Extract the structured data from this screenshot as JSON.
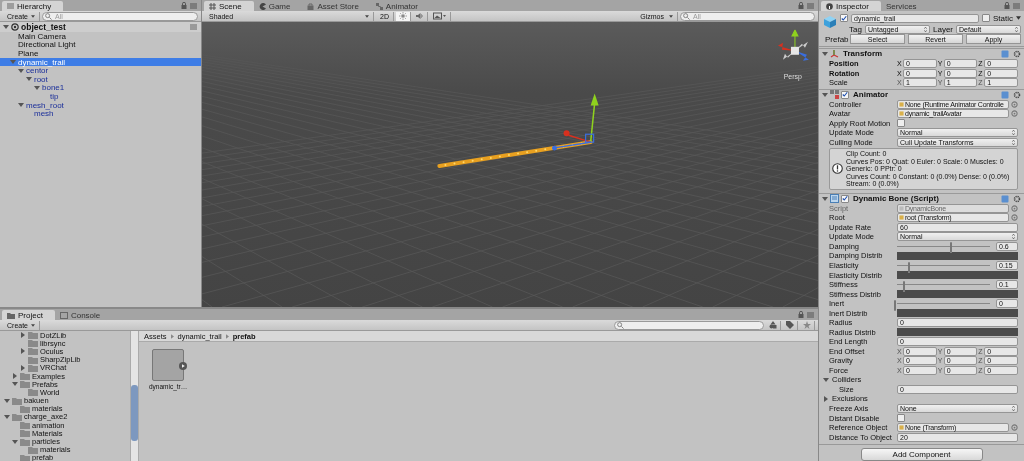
{
  "hierarchy": {
    "title": "Hierarchy",
    "create": "Create",
    "search_placeholder": "All",
    "scene": {
      "label": "object_test",
      "expanded": true,
      "children": [
        {
          "label": "Main Camera",
          "prefab": false,
          "selected": false
        },
        {
          "label": "Directional Light",
          "prefab": false,
          "selected": false
        },
        {
          "label": "Plane",
          "prefab": false,
          "selected": false
        },
        {
          "label": "dynamic_trail",
          "prefab": true,
          "selected": true,
          "expanded": true,
          "children": [
            {
              "label": "centor",
              "prefab": true,
              "selected": false,
              "expanded": true,
              "children": [
                {
                  "label": "root",
                  "prefab": true,
                  "selected": false,
                  "expanded": true,
                  "children": [
                    {
                      "label": "bone1",
                      "prefab": true,
                      "selected": false,
                      "expanded": true,
                      "children": [
                        {
                          "label": "tip",
                          "prefab": true,
                          "selected": false
                        }
                      ]
                    }
                  ]
                }
              ]
            },
            {
              "label": "mesh_root",
              "prefab": true,
              "selected": false,
              "expanded": true,
              "children": [
                {
                  "label": "mesh",
                  "prefab": true,
                  "selected": false
                }
              ]
            }
          ]
        }
      ]
    }
  },
  "scene_view": {
    "tabs": [
      {
        "label": "Scene",
        "selected": true
      },
      {
        "label": "Game",
        "selected": false
      },
      {
        "label": "Asset Store",
        "selected": false
      },
      {
        "label": "Animator",
        "selected": false
      }
    ],
    "shading": "Shaded",
    "mode_2d": "2D",
    "lighting": true,
    "audio": false,
    "gizmos": "Gizmos",
    "search_placeholder": "All",
    "projection": "Persp"
  },
  "inspector": {
    "tabs": [
      {
        "label": "Inspector",
        "selected": true
      },
      {
        "label": "Services",
        "selected": false
      }
    ],
    "object": {
      "active": true,
      "name": "dynamic_trail",
      "static": false,
      "static_label": "Static",
      "tag_label": "Tag",
      "tag": "Untagged",
      "layer_label": "Layer",
      "layer": "Default",
      "prefab_label": "Prefab",
      "prefab_buttons": [
        "Select",
        "Revert",
        "Apply"
      ]
    },
    "components": [
      {
        "kind": "transform",
        "title": "Transform",
        "rows": [
          {
            "kind": "vector",
            "label": "Position",
            "modified": true,
            "values": [
              {
                "axis": "X",
                "value": "0"
              },
              {
                "axis": "Y",
                "value": "0"
              },
              {
                "axis": "Z",
                "value": "0"
              }
            ]
          },
          {
            "kind": "vector",
            "label": "Rotation",
            "modified": true,
            "values": [
              {
                "axis": "X",
                "value": "0"
              },
              {
                "axis": "Y",
                "value": "0"
              },
              {
                "axis": "Z",
                "value": "0"
              }
            ]
          },
          {
            "kind": "vector",
            "label": "Scale",
            "modified": false,
            "values": [
              {
                "axis": "X",
                "value": "1"
              },
              {
                "axis": "Y",
                "value": "1"
              },
              {
                "axis": "Z",
                "value": "1"
              }
            ]
          }
        ]
      },
      {
        "kind": "animator",
        "title": "Animator",
        "enabled": true,
        "rows": [
          {
            "kind": "object",
            "label": "Controller",
            "value": "None (Runtime Animator Controlle",
            "disabled": false
          },
          {
            "kind": "object",
            "label": "Avatar",
            "value": "dynamic_trailAvatar",
            "disabled": false
          },
          {
            "kind": "checkbox",
            "label": "Apply Root Motion",
            "checked": false
          },
          {
            "kind": "dropdown",
            "label": "Update Mode",
            "value": "Normal"
          },
          {
            "kind": "dropdown",
            "label": "Culling Mode",
            "value": "Cull Update Transforms"
          }
        ],
        "info": [
          "Clip Count: 0",
          "Curves Pos: 0 Quat: 0 Euler: 0 Scale: 0 Muscles: 0 Generic: 0 PPtr: 0",
          "Curves Count: 0 Constant: 0 (0.0%) Dense: 0 (0.0%) Stream: 0 (0.0%)"
        ]
      },
      {
        "kind": "script",
        "title": "Dynamic Bone (Script)",
        "enabled": true,
        "rows": [
          {
            "kind": "object",
            "label": "Script",
            "value": "DynamicBone",
            "disabled": true
          },
          {
            "kind": "object",
            "label": "Root",
            "value": "root (Transform)",
            "disabled": false
          },
          {
            "kind": "number",
            "label": "Update Rate",
            "value": "60"
          },
          {
            "kind": "dropdown",
            "label": "Update Mode",
            "value": "Normal"
          },
          {
            "kind": "slider",
            "label": "Damping",
            "level": 0.6,
            "value": "0.6"
          },
          {
            "kind": "curve",
            "label": "Damping Distrib"
          },
          {
            "kind": "slider",
            "label": "Elasticity",
            "level": 0.15,
            "value": "0.15"
          },
          {
            "kind": "curve",
            "label": "Elasticity Distrib"
          },
          {
            "kind": "slider",
            "label": "Stiffness",
            "level": 0.1,
            "value": "0.1"
          },
          {
            "kind": "curve",
            "label": "Stiffness Distrib"
          },
          {
            "kind": "slider",
            "label": "Inert",
            "level": 0,
            "value": "0"
          },
          {
            "kind": "curve",
            "label": "Inert Distrib"
          },
          {
            "kind": "number",
            "label": "Radius",
            "value": "0"
          },
          {
            "kind": "curve",
            "label": "Radius Distrib"
          },
          {
            "kind": "number",
            "label": "End Length",
            "value": "0"
          },
          {
            "kind": "vector",
            "label": "End Offset",
            "modified": false,
            "values": [
              {
                "axis": "X",
                "value": "0"
              },
              {
                "axis": "Y",
                "value": "0"
              },
              {
                "axis": "Z",
                "value": "0"
              }
            ]
          },
          {
            "kind": "vector",
            "label": "Gravity",
            "modified": false,
            "values": [
              {
                "axis": "X",
                "value": "0"
              },
              {
                "axis": "Y",
                "value": "0"
              },
              {
                "axis": "Z",
                "value": "0"
              }
            ]
          },
          {
            "kind": "vector",
            "label": "Force",
            "modified": false,
            "values": [
              {
                "axis": "X",
                "value": "0"
              },
              {
                "axis": "Y",
                "value": "0"
              },
              {
                "axis": "Z",
                "value": "0"
              }
            ]
          },
          {
            "kind": "foldout",
            "label": "Colliders",
            "expanded": true,
            "children": [
              {
                "kind": "number",
                "label": "Size",
                "value": "0"
              }
            ]
          },
          {
            "kind": "foldout",
            "label": "Exclusions",
            "expanded": false
          },
          {
            "kind": "dropdown",
            "label": "Freeze Axis",
            "value": "None"
          },
          {
            "kind": "checkbox",
            "label": "Distant Disable",
            "checked": false
          },
          {
            "kind": "object",
            "label": "Reference Object",
            "value": "None (Transform)",
            "disabled": false
          },
          {
            "kind": "number",
            "label": "Distance To Object",
            "value": "20"
          }
        ]
      }
    ],
    "add_component": "Add Component"
  },
  "project": {
    "tabs": [
      {
        "label": "Project",
        "selected": true
      },
      {
        "label": "Console",
        "selected": false
      }
    ],
    "create": "Create",
    "tree": [
      {
        "children": [
          {
            "children": [
              {
                "label": "DotZLib",
                "expanded": false
              },
              {
                "label": "librsync"
              },
              {
                "label": "Oculus",
                "expanded": false
              },
              {
                "label": "SharpZipLib"
              },
              {
                "label": "VRChat",
                "expanded": false
              }
            ]
          },
          {
            "label": "Examples",
            "expanded": false
          },
          {
            "label": "Prefabs",
            "expanded": true,
            "children": [
              {
                "label": "World"
              }
            ]
          }
        ]
      },
      {
        "label": "bakuen",
        "expanded": true,
        "children": [
          {
            "label": "materials"
          }
        ]
      },
      {
        "label": "charge_axe2",
        "expanded": true,
        "children": [
          {
            "label": "animation"
          },
          {
            "label": "Materials"
          },
          {
            "label": "particles",
            "expanded": true,
            "children": [
              {
                "label": "materials"
              }
            ]
          },
          {
            "label": "prefab"
          }
        ]
      }
    ],
    "breadcrumb": [
      "Assets",
      "dynamic_trail",
      "prefab"
    ],
    "assets": [
      {
        "label": "dynamic_tr…"
      }
    ]
  }
}
